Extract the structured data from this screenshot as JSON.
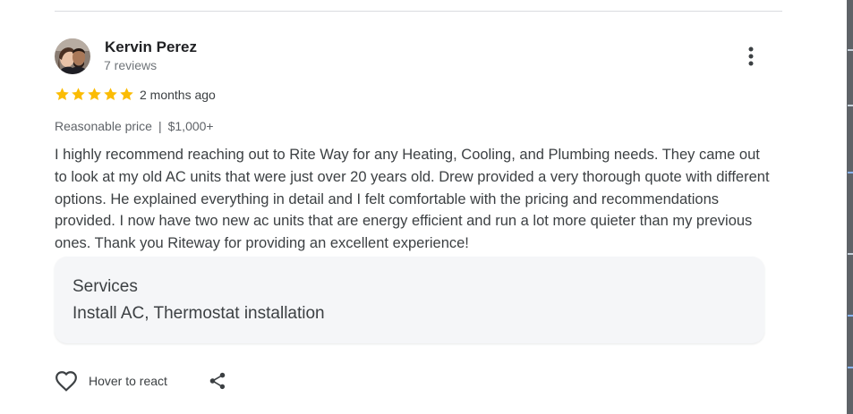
{
  "reviewer": {
    "name": "Kervin Perez",
    "review_count": "7 reviews",
    "avatar_icon": "profile-photo"
  },
  "review": {
    "rating": 5,
    "rating_max": 5,
    "star_color": "#fbbc04",
    "date": "2 months ago",
    "price_label": "Reasonable price",
    "price_separator": "|",
    "price_value": "$1,000+",
    "text": "I highly recommend reaching out to Rite Way for any Heating, Cooling, and Plumbing needs. They came out to look at my old AC units that were just over 20 years old. Drew provided a very thorough quote with different options. He explained everything in detail and I felt comfortable with the pricing and recommendations provided. I now have two new ac units that are energy efficient and run a lot more quieter than my previous ones. Thank you Riteway for providing an excellent experience!"
  },
  "services": {
    "title": "Services",
    "value": "Install AC, Thermostat installation"
  },
  "actions": {
    "react_label": "Hover to react",
    "react_icon": "heart-outline-icon",
    "share_icon": "share-icon",
    "more_icon": "more-vertical-icon"
  },
  "colors": {
    "text_primary": "#202124",
    "text_body": "#3c4043",
    "text_secondary": "#70757a",
    "card_background": "#f5f6f8",
    "divider": "#dadce0"
  }
}
